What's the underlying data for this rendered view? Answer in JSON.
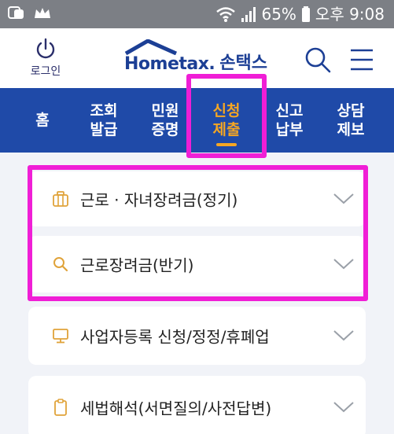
{
  "status_bar": {
    "battery": "65%",
    "time": "오후 9:08"
  },
  "header": {
    "login_label": "로그인",
    "logo_text": "Hometax.",
    "logo_kr": "손택스"
  },
  "nav": {
    "items": [
      {
        "line1": "홈",
        "line2": ""
      },
      {
        "line1": "조회",
        "line2": "발급"
      },
      {
        "line1": "민원",
        "line2": "증명"
      },
      {
        "line1": "신청",
        "line2": "제출"
      },
      {
        "line1": "신고",
        "line2": "납부"
      },
      {
        "line1": "상담",
        "line2": "제보"
      }
    ],
    "active_index": 3
  },
  "list": {
    "items": [
      {
        "label": "근로 · 자녀장려금(정기)",
        "icon": "briefcase-icon"
      },
      {
        "label": "근로장려금(반기)",
        "icon": "search-icon"
      },
      {
        "label": "사업자등록 신청/정정/휴폐업",
        "icon": "monitor-icon"
      },
      {
        "label": "세법해석(서면질의/사전답변)",
        "icon": "clipboard-icon"
      }
    ]
  },
  "colors": {
    "brand_blue": "#1f4aa8",
    "accent_orange": "#f5a623",
    "highlight_magenta": "#f01ed6"
  }
}
